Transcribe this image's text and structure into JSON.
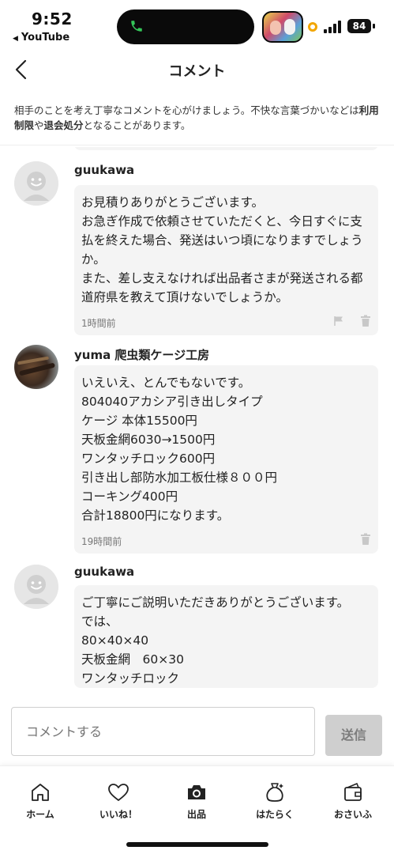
{
  "status_bar": {
    "time": "9:52",
    "back_app": "YouTube",
    "battery": "84",
    "icons": [
      "phone-icon",
      "signal-icon",
      "battery-icon",
      "recording-indicator"
    ]
  },
  "header": {
    "title": "コメント",
    "back_icon": "chevron-left-icon"
  },
  "notice": {
    "text_1": "相手のことを考え丁寧なコメントを心がけましょう。不快な言葉づかいなどは",
    "bold_1": "利用制限",
    "text_2": "や",
    "bold_2": "退会処分",
    "text_3": "となることがあります。"
  },
  "comments": [
    {
      "user": "guukawa",
      "avatar": "default-avatar-icon",
      "text": "お見積りありがとうございます。\nお急ぎ作成で依頼させていただくと、今日すぐに支払を終えた場合、発送はいつ頃になりますでしょうか。\nまた、差し支えなければ出品者さまが発送される都道府県を教えて頂けないでしょうか。",
      "time": "1時間前",
      "actions": [
        "flag-icon",
        "trash-icon"
      ]
    },
    {
      "user": "yuma 爬虫類ケージ工房",
      "avatar": "user-photo",
      "text": "いえいえ、とんでもないです。\n804040アカシア引き出しタイプ\nケージ 本体15500円\n天板金網6030→1500円\nワンタッチロック600円\n引き出し部防水加工板仕様８００円\nコーキング400円\n合計18800円になります。",
      "time": "19時間前",
      "actions": [
        "trash-icon"
      ]
    },
    {
      "user": "guukawa",
      "avatar": "default-avatar-icon",
      "text": "ご丁寧にご説明いただきありがとうございます。\nでは、\n80×40×40\n天板金網　60×30\nワンタッチロック"
    }
  ],
  "input": {
    "placeholder": "コメントする",
    "send_label": "送信"
  },
  "nav": [
    {
      "label": "ホーム",
      "icon": "home-icon"
    },
    {
      "label": "いいね！",
      "icon": "heart-icon"
    },
    {
      "label": "出品",
      "icon": "camera-icon"
    },
    {
      "label": "はたらく",
      "icon": "money-bag-icon"
    },
    {
      "label": "おさいふ",
      "icon": "wallet-icon"
    }
  ],
  "colors": {
    "bubble_bg": "#f4f4f4",
    "send_button_bg": "#cfcfcf",
    "text": "#222222",
    "muted": "#777777"
  }
}
